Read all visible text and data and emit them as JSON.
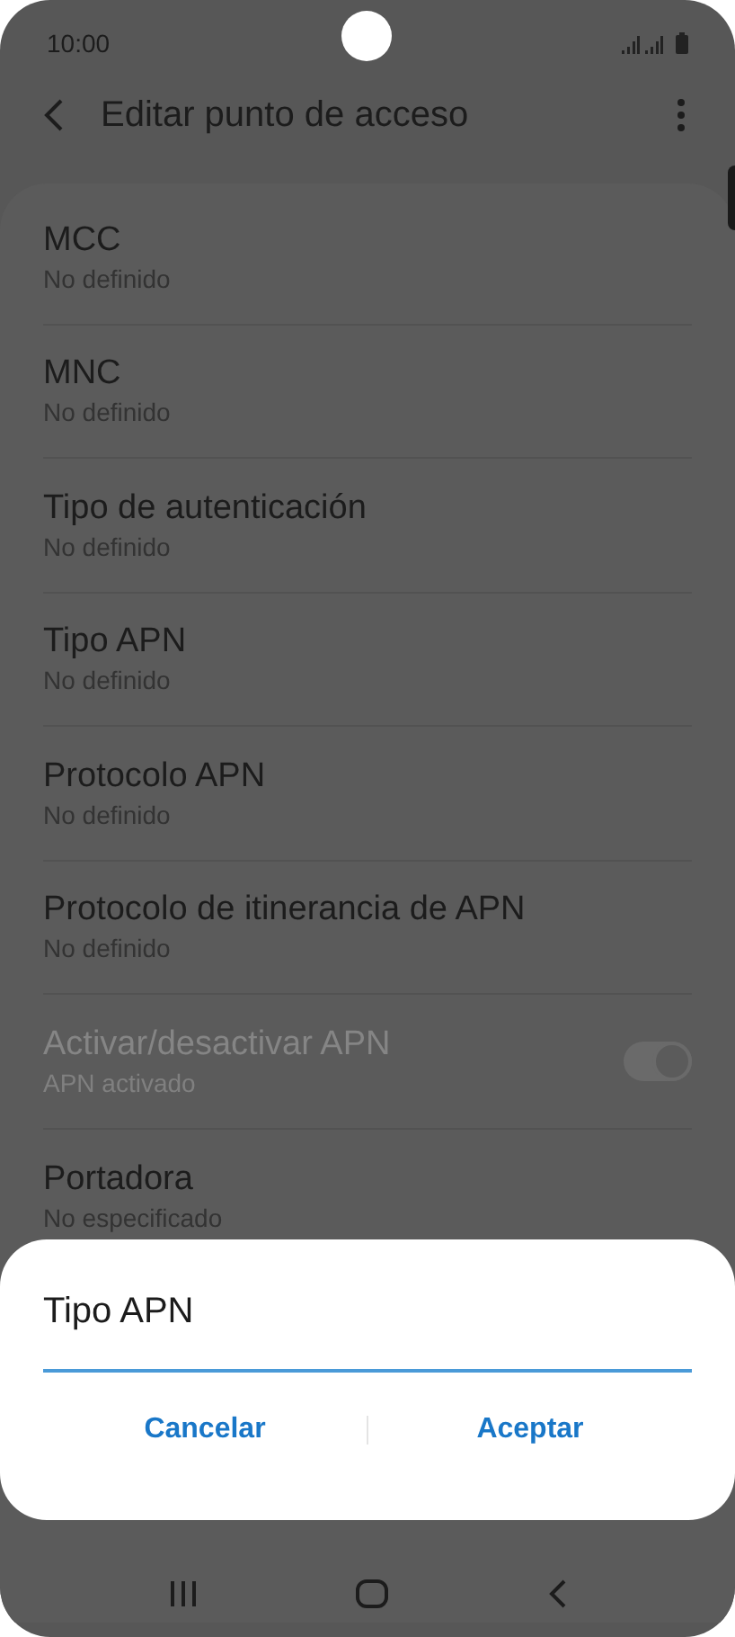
{
  "status_bar": {
    "time": "10:00"
  },
  "header": {
    "title": "Editar punto de acceso"
  },
  "settings": [
    {
      "kind": "text",
      "title": "MCC",
      "value": "No definido",
      "disabled": false
    },
    {
      "kind": "text",
      "title": "MNC",
      "value": "No definido",
      "disabled": false
    },
    {
      "kind": "text",
      "title": "Tipo de autenticación",
      "value": "No definido",
      "disabled": false
    },
    {
      "kind": "text",
      "title": "Tipo APN",
      "value": "No definido",
      "disabled": false
    },
    {
      "kind": "text",
      "title": "Protocolo APN",
      "value": "No definido",
      "disabled": false
    },
    {
      "kind": "text",
      "title": "Protocolo de itinerancia de APN",
      "value": "No definido",
      "disabled": false
    },
    {
      "kind": "toggle",
      "title": "Activar/desactivar APN",
      "value": "APN activado",
      "disabled": true,
      "on": true
    },
    {
      "kind": "text",
      "title": "Portadora",
      "value": "No especificado",
      "disabled": false
    }
  ],
  "dialog": {
    "title": "Tipo APN",
    "buttons": [
      "Cancelar",
      "Aceptar"
    ]
  }
}
